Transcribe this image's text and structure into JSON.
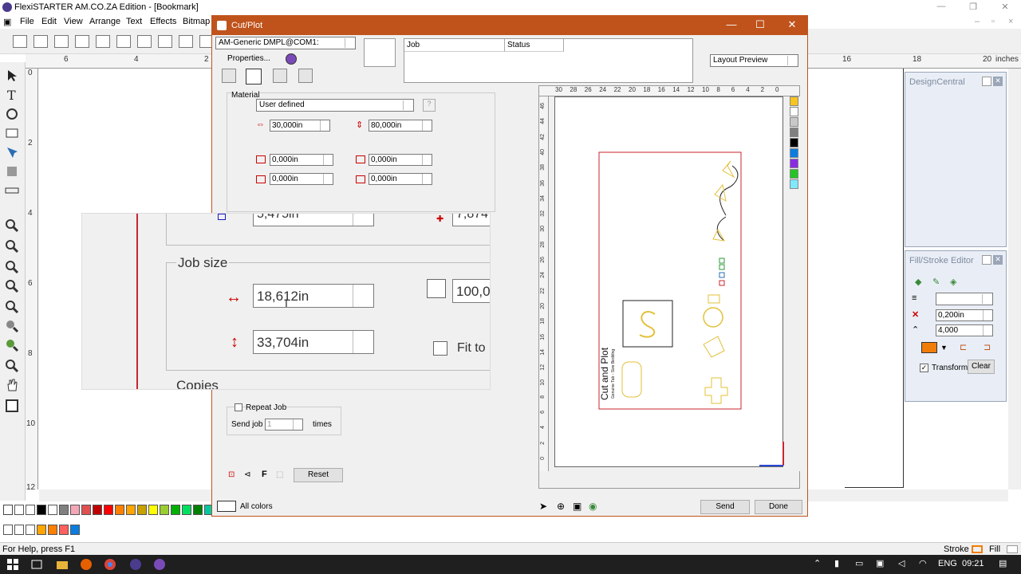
{
  "app": {
    "title": "FlexiSTARTER AM.CO.ZA Edition - [Bookmark]",
    "menu": [
      "File",
      "Edit",
      "View",
      "Arrange",
      "Text",
      "Effects",
      "Bitmap"
    ],
    "ruler_labels": [
      "6",
      "4",
      "2",
      "16",
      "18",
      "20",
      "inches"
    ],
    "vruler_labels": [
      "0",
      "2",
      "4",
      "6",
      "8",
      "10",
      "12"
    ]
  },
  "statusbar": {
    "help": "For Help, press F1",
    "stroke_label": "Stroke",
    "fill_label": "Fill"
  },
  "taskbar": {
    "lang": "ENG",
    "time": "09:21"
  },
  "design_central": {
    "title": "DesignCentral"
  },
  "fill_stroke": {
    "title": "Fill/Stroke Editor",
    "width_value": "0,200in",
    "miter_value": "4,000",
    "transform_label": "Transform",
    "clear_label": "Clear",
    "swatch_color": "#f07d0a"
  },
  "cutplot": {
    "title": "Cut/Plot",
    "device": "AM-Generic DMPL@COM1:",
    "properties_label": "Properties...",
    "job_col": "Job",
    "status_col": "Status",
    "preview_mode": "Layout Preview",
    "material_label": "Material",
    "material_value": "User defined",
    "width_value": "30,000in",
    "length_value": "80,000in",
    "margin_tl": "0,000in",
    "margin_tr": "0,000in",
    "margin_bl": "0,000in",
    "margin_br": "0,000in",
    "zoom_partial_top_left": "5,475in",
    "zoom_partial_top_right": "7,874",
    "job_size_label": "Job size",
    "job_width": "18,612in",
    "job_height": "33,704in",
    "scale_partial": "100,0",
    "fit_to_label": "Fit to",
    "copies_label": "Copies",
    "repeat_job_label": "Repeat Job",
    "send_job_label": "Send job",
    "send_job_value": "1",
    "times_label": "times",
    "reset_label": "Reset",
    "all_colors_label": "All colors",
    "send_label": "Send",
    "done_label": "Done",
    "preview_ruler": [
      "30",
      "28",
      "26",
      "24",
      "22",
      "20",
      "18",
      "16",
      "14",
      "12",
      "10",
      "8",
      "6",
      "4",
      "2",
      "0"
    ],
    "preview_vruler": [
      "46",
      "44",
      "42",
      "40",
      "38",
      "36",
      "34",
      "32",
      "30",
      "28",
      "26",
      "24",
      "22",
      "20",
      "18",
      "16",
      "14",
      "12",
      "10",
      "8",
      "6",
      "4",
      "2",
      "0"
    ],
    "layout_text_main": "Cut and Plot",
    "layout_text_sub": "Genuine Tab - Size Bedding",
    "color_strip": [
      "#f7c520",
      "#ffffff",
      "#c8c8c8",
      "#808080",
      "#000000",
      "#0b7de0",
      "#8a2be2",
      "#25c425",
      "#7fe8ff"
    ]
  },
  "palette": [
    "#000000",
    "#ffffff",
    "#808080",
    "#f4a6b6",
    "#e05050",
    "#c00000",
    "#ff0000",
    "#ff8000",
    "#ffa500",
    "#c8a000",
    "#ffff00",
    "#9acd32",
    "#00b000",
    "#00e060",
    "#008000",
    "#00c8a0"
  ],
  "palette2": [
    "#ffa500",
    "#ff8000",
    "#ff6060",
    "#0b7de0"
  ]
}
